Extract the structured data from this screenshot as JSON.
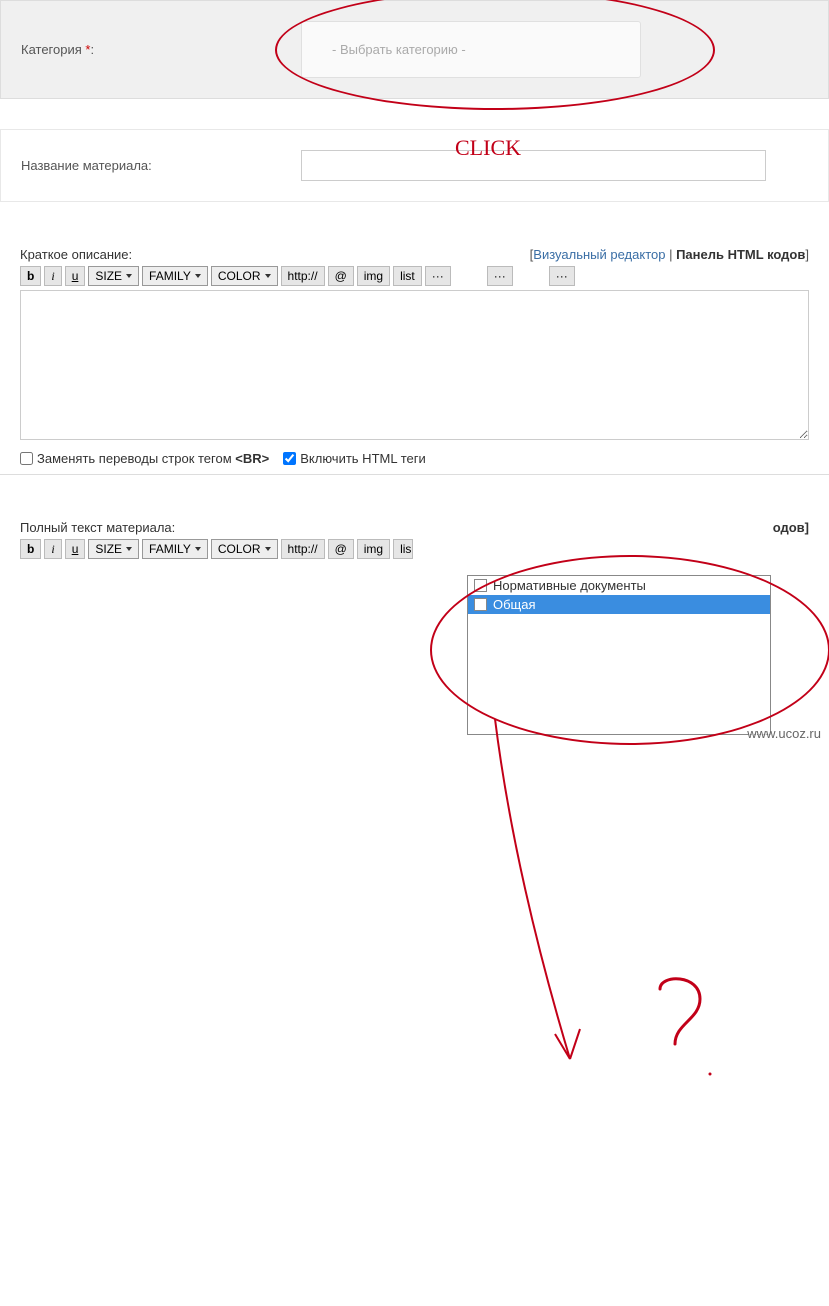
{
  "category": {
    "label": "Категория",
    "required_marker": "*",
    "placeholder": "- Выбрать категорию -"
  },
  "material_name": {
    "label": "Название материала:"
  },
  "short_desc": {
    "label": "Краткое описание:",
    "editor_switch": {
      "open": "[",
      "link": "Визуальный редактор",
      "sep": " | ",
      "bold": "Панель HTML кодов",
      "close": "]"
    }
  },
  "full_text": {
    "label": "Полный текст материала:",
    "editor_tail": "одов]"
  },
  "toolbar": {
    "b": "b",
    "i": "i",
    "u": "u",
    "size": "SIZE",
    "family": "FAMILY",
    "color": "COLOR",
    "http": "http://",
    "at": "@",
    "img": "img",
    "list": "list",
    "dots": "···"
  },
  "checkboxes": {
    "br_replace_pre": "Заменять переводы строк тегом ",
    "br_tag": "<BR>",
    "html_tags": "Включить HTML теги"
  },
  "popup": {
    "items": [
      {
        "label": "Нормативные документы",
        "selected": false
      },
      {
        "label": "Общая",
        "selected": true
      }
    ]
  },
  "annotation": {
    "click": "CLICK"
  },
  "watermark": "www.ucoz.ru"
}
